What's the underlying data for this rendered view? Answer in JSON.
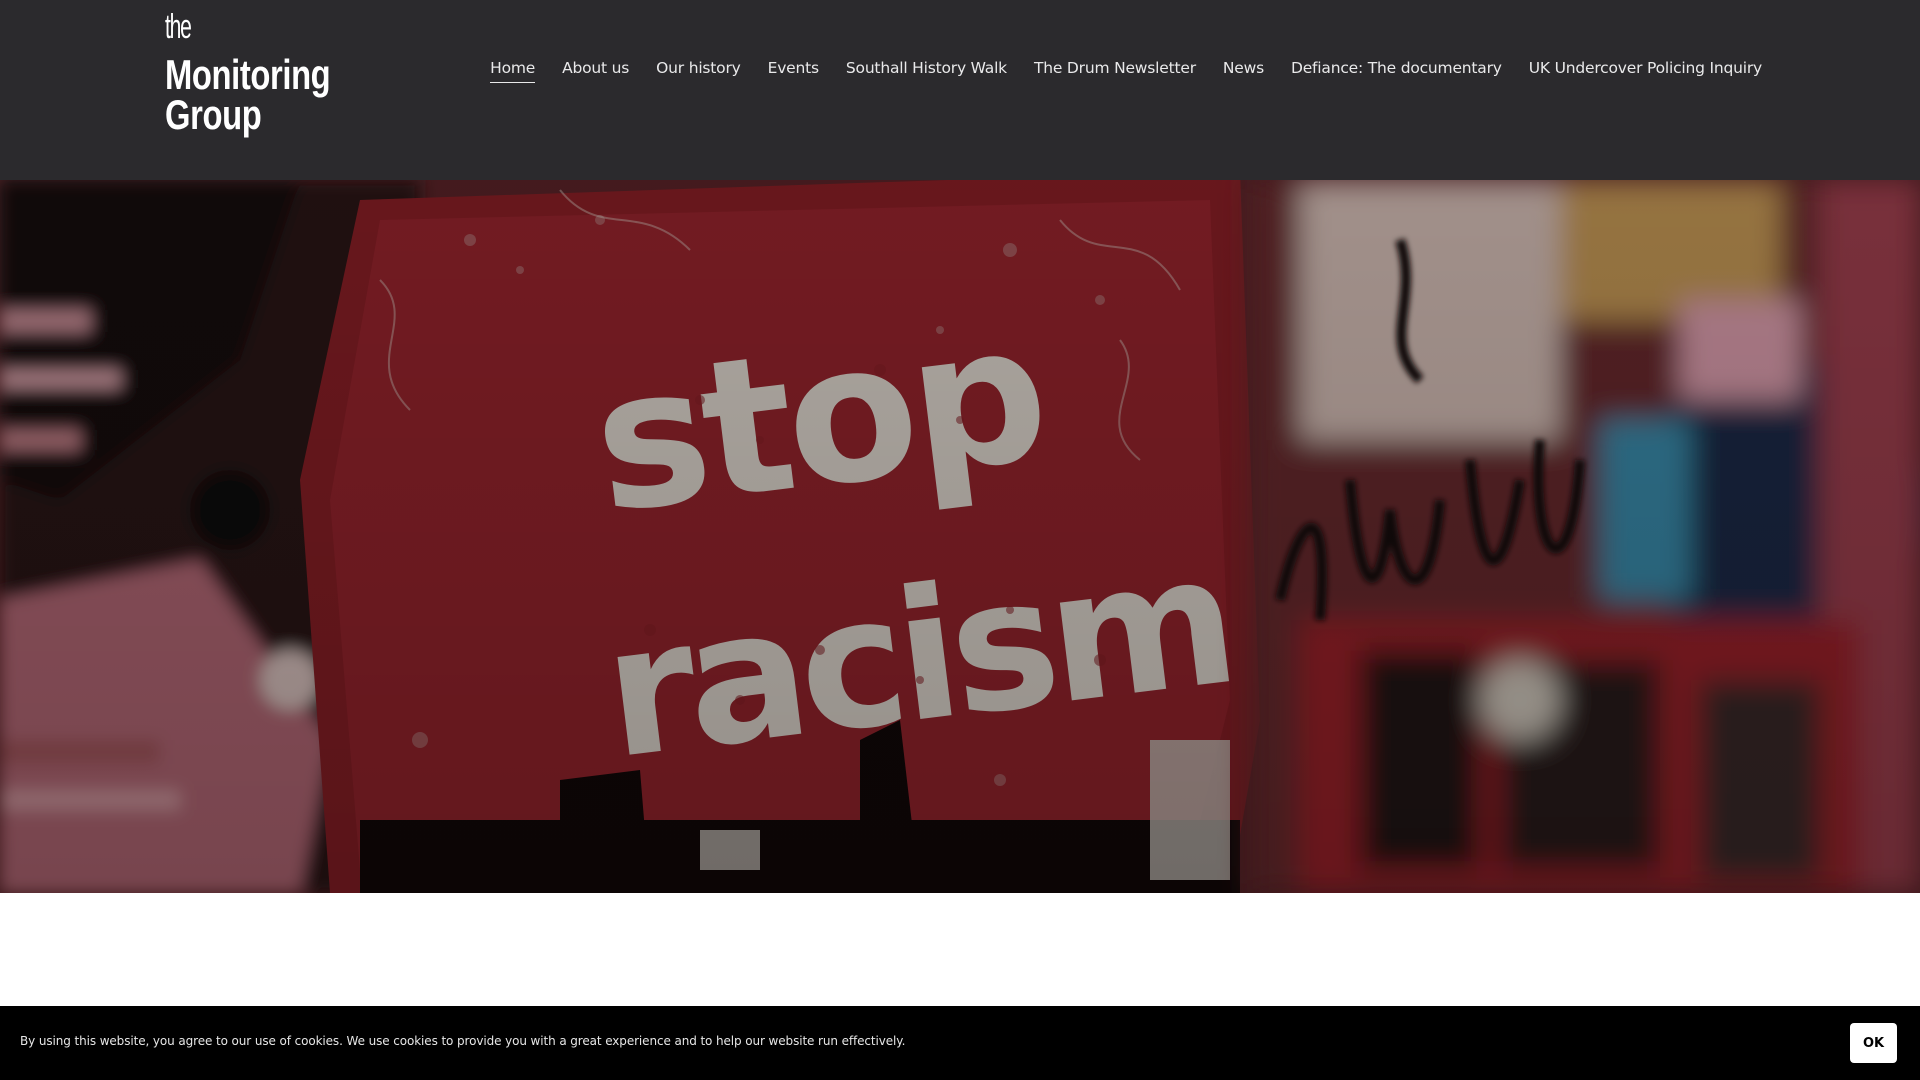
{
  "logo": {
    "line_the": "the",
    "line_1": "Monitoring",
    "line_2": "Group"
  },
  "nav": {
    "items": [
      {
        "label": "Home",
        "active": true
      },
      {
        "label": "About us"
      },
      {
        "label": "Our history"
      },
      {
        "label": "Events"
      },
      {
        "label": "Southall History Walk"
      },
      {
        "label": "The Drum Newsletter"
      },
      {
        "label": "News"
      },
      {
        "label": "Defiance: The documentary"
      },
      {
        "label": "UK Undercover Policing Inquiry"
      }
    ]
  },
  "hero": {
    "painted_text_1": "stop",
    "painted_text_2": "racism"
  },
  "cookie": {
    "message": "By using this website, you agree to our use of cookies. We use cookies to provide you with a great experience and to help our website run effectively.",
    "ok_label": "OK"
  },
  "colors": {
    "header_bg": "#2b2a2d",
    "nav_text": "#e9e9ea",
    "cookie_bg": "#000000",
    "hero_red": "#7a1e24"
  }
}
